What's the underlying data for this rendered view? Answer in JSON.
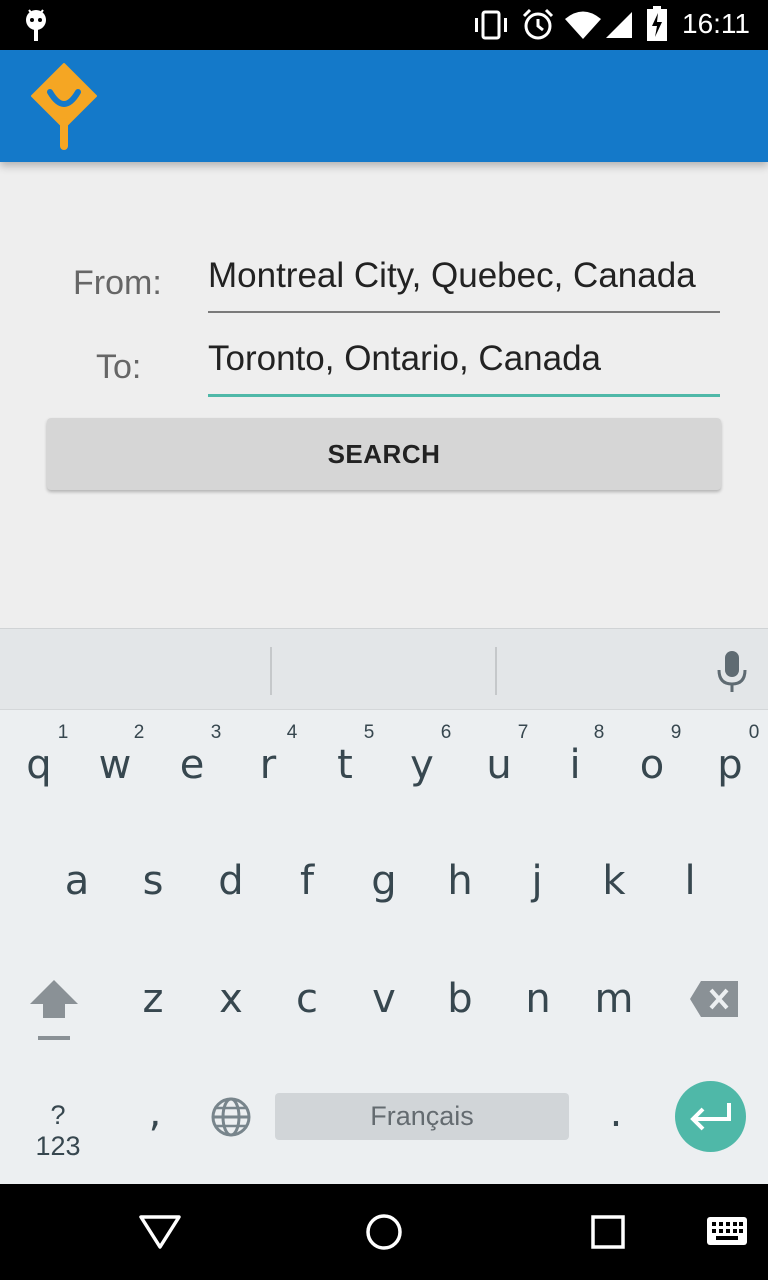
{
  "status_bar": {
    "time": "16:11"
  },
  "form": {
    "from_label": "From:",
    "from_value": "Montreal City, Quebec, Canada",
    "to_label": "To:",
    "to_value": "Toronto, Ontario, Canada",
    "search_label": "SEARCH"
  },
  "keyboard": {
    "row1": [
      {
        "k": "q",
        "h": "1"
      },
      {
        "k": "w",
        "h": "2"
      },
      {
        "k": "e",
        "h": "3"
      },
      {
        "k": "r",
        "h": "4"
      },
      {
        "k": "t",
        "h": "5"
      },
      {
        "k": "y",
        "h": "6"
      },
      {
        "k": "u",
        "h": "7"
      },
      {
        "k": "i",
        "h": "8"
      },
      {
        "k": "o",
        "h": "9"
      },
      {
        "k": "p",
        "h": "0"
      }
    ],
    "row2": [
      "a",
      "s",
      "d",
      "f",
      "g",
      "h",
      "j",
      "k",
      "l"
    ],
    "row3": [
      "z",
      "x",
      "c",
      "v",
      "b",
      "n",
      "m"
    ],
    "symbols_label": "?123",
    "comma": ",",
    "space_label": "Français",
    "period": "."
  },
  "colors": {
    "app_bar": "#1479c9",
    "logo": "#f5a623",
    "accent": "#4fb8a8"
  }
}
